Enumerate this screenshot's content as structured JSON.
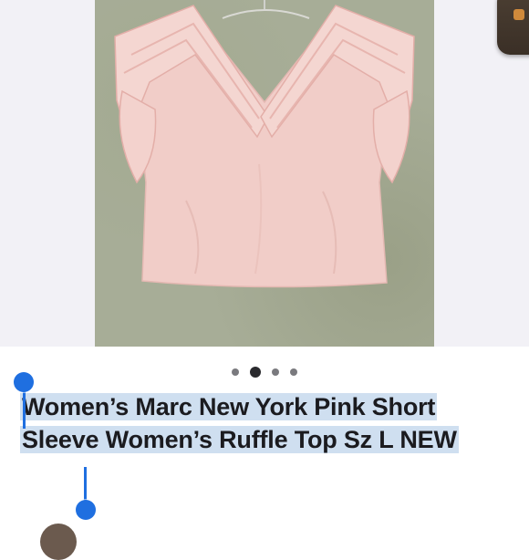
{
  "listing": {
    "title": "Women’s Marc New York Pink Short Sleeve Women’s Ruffle Top Sz L NEW"
  },
  "carousel": {
    "total_images": 4,
    "active_index": 2
  },
  "colors": {
    "wall": "#a7ad97",
    "garment": "#f1cdc8",
    "selection_highlight": "#cfdff0",
    "selection_handle": "#1f6fe0",
    "text": "#1b1b1f"
  },
  "icons": {
    "corner_widget": "app-icon",
    "pagination": "page-dot-icon"
  }
}
